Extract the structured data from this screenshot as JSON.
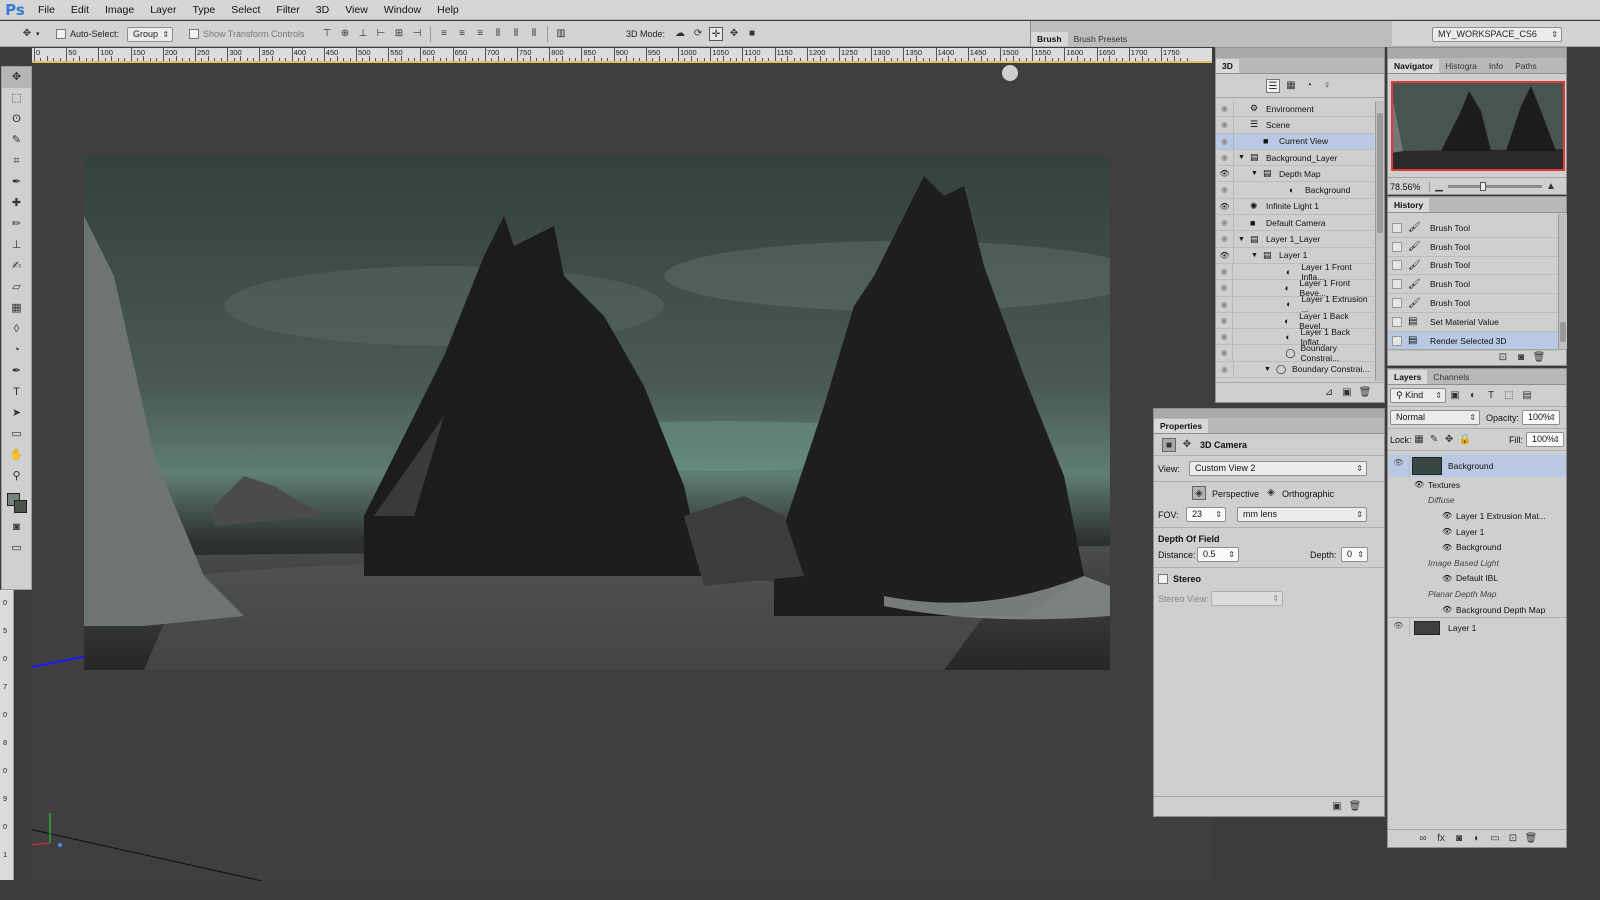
{
  "app": {
    "logo": "Ps"
  },
  "menu": [
    "File",
    "Edit",
    "Image",
    "Layer",
    "Type",
    "Select",
    "Filter",
    "3D",
    "View",
    "Window",
    "Help"
  ],
  "options_bar": {
    "auto_select_label": "Auto-Select:",
    "group_value": "Group",
    "show_transform_label": "Show Transform Controls",
    "mode_label": "3D Mode:",
    "brush_tab": "Brush",
    "brush_presets_tab": "Brush Presets",
    "workspace": "MY_WORKSPACE_CS6"
  },
  "ruler_labels": [
    "0",
    "50",
    "100",
    "150",
    "200",
    "250",
    "300",
    "350",
    "400",
    "450",
    "500",
    "550",
    "600",
    "650",
    "700",
    "750",
    "800",
    "850",
    "900",
    "950",
    "1000",
    "1050",
    "1100",
    "1150",
    "1200",
    "1250",
    "1300",
    "1350",
    "1400",
    "1450",
    "1500",
    "1550",
    "1600",
    "1650",
    "1700",
    "1750"
  ],
  "ruler_left_labels": [
    "0",
    "5",
    "0",
    "7",
    "0",
    "8",
    "0",
    "9",
    "0",
    "1"
  ],
  "tools": [
    "move",
    "marquee",
    "lasso",
    "quick-select",
    "crop",
    "eyedropper",
    "healing",
    "brush",
    "stamp",
    "history-brush",
    "eraser",
    "gradient",
    "blur",
    "dodge",
    "pen",
    "type",
    "path-select",
    "shape",
    "hand",
    "zoom"
  ],
  "panel_3d": {
    "tab": "3D",
    "rows": [
      {
        "label": "Environment",
        "indent": 0,
        "eye": false,
        "expand": "",
        "icon": "environment-icon"
      },
      {
        "label": "Scene",
        "indent": 0,
        "eye": false,
        "expand": "",
        "icon": "scene-icon"
      },
      {
        "label": "Current View",
        "indent": 1,
        "eye": false,
        "expand": "",
        "icon": "camera-icon",
        "selected": true
      },
      {
        "label": "Background_Layer",
        "indent": 0,
        "eye": false,
        "expand": "▼",
        "icon": "mesh-icon"
      },
      {
        "label": "Depth Map",
        "indent": 1,
        "eye": true,
        "expand": "▼",
        "icon": "mesh-icon"
      },
      {
        "label": "Background",
        "indent": 3,
        "eye": false,
        "expand": "",
        "icon": "material-icon"
      },
      {
        "label": "Infinite Light 1",
        "indent": 0,
        "eye": true,
        "expand": "",
        "icon": "light-icon"
      },
      {
        "label": "Default Camera",
        "indent": 0,
        "eye": false,
        "expand": "",
        "icon": "camera-icon"
      },
      {
        "label": "Layer 1_Layer",
        "indent": 0,
        "eye": false,
        "expand": "▼",
        "icon": "mesh-icon"
      },
      {
        "label": "Layer 1",
        "indent": 1,
        "eye": true,
        "expand": "▼",
        "icon": "mesh-icon"
      },
      {
        "label": "Layer 1 Front Infla...",
        "indent": 3,
        "eye": false,
        "expand": "",
        "icon": "material-icon"
      },
      {
        "label": "Layer 1 Front Beve...",
        "indent": 3,
        "eye": false,
        "expand": "",
        "icon": "material-icon"
      },
      {
        "label": "Layer 1 Extrusion ...",
        "indent": 3,
        "eye": false,
        "expand": "",
        "icon": "material-icon"
      },
      {
        "label": "Layer 1 Back Bevel...",
        "indent": 3,
        "eye": false,
        "expand": "",
        "icon": "material-icon"
      },
      {
        "label": "Layer 1 Back Inflat...",
        "indent": 3,
        "eye": false,
        "expand": "",
        "icon": "material-icon"
      },
      {
        "label": "Boundary Constrai...",
        "indent": 3,
        "eye": false,
        "expand": "",
        "icon": "constraint-icon"
      },
      {
        "label": "Boundary Constrai...",
        "indent": 2,
        "eye": false,
        "expand": "▼",
        "icon": "constraint-icon"
      }
    ]
  },
  "properties": {
    "tab": "Properties",
    "title": "3D Camera",
    "view_label": "View:",
    "view_value": "Custom View 2",
    "perspective": "Perspective",
    "orthographic": "Orthographic",
    "fov_label": "FOV:",
    "fov_value": "23",
    "lens_value": "mm lens",
    "dof_heading": "Depth Of Field",
    "distance_label": "Distance:",
    "distance_value": "0.5",
    "depth_label": "Depth:",
    "depth_value": "0",
    "stereo_label": "Stereo",
    "stereo_view_label": "Stereo View:"
  },
  "navigator": {
    "tabs": [
      "Navigator",
      "Histogra",
      "Info",
      "Paths"
    ],
    "zoom": "78.56%"
  },
  "history": {
    "tab": "History",
    "items": [
      {
        "label": "Brush Tool",
        "icon": "brush-icon"
      },
      {
        "label": "Brush Tool",
        "icon": "brush-icon"
      },
      {
        "label": "Brush Tool",
        "icon": "brush-icon"
      },
      {
        "label": "Brush Tool",
        "icon": "brush-icon"
      },
      {
        "label": "Brush Tool",
        "icon": "brush-icon"
      },
      {
        "label": "Set Material Value",
        "icon": "document-icon"
      },
      {
        "label": "Render Selected 3D",
        "icon": "document-icon",
        "selected": true
      }
    ]
  },
  "layers": {
    "tabs": [
      "Layers",
      "Channels"
    ],
    "kind": "Kind",
    "blend": "Normal",
    "opacity_label": "Opacity:",
    "opacity": "100%",
    "lock_label": "Lock:",
    "fill_label": "Fill:",
    "fill": "100%",
    "background_layer": "Background",
    "sublayers": [
      {
        "label": "Textures",
        "indent": 1,
        "eye": true,
        "italic": false
      },
      {
        "label": "Diffuse",
        "indent": 2,
        "eye": false,
        "italic": true
      },
      {
        "label": "Layer 1 Extrusion Mat...",
        "indent": 3,
        "eye": true,
        "italic": false
      },
      {
        "label": "Layer 1",
        "indent": 3,
        "eye": true,
        "italic": false
      },
      {
        "label": "Background",
        "indent": 3,
        "eye": true,
        "italic": false
      },
      {
        "label": "Image Based Light",
        "indent": 2,
        "eye": false,
        "italic": true
      },
      {
        "label": "Default IBL",
        "indent": 3,
        "eye": true,
        "italic": false
      },
      {
        "label": "Planar Depth Map",
        "indent": 2,
        "eye": false,
        "italic": true
      },
      {
        "label": "Background Depth Map",
        "indent": 3,
        "eye": true,
        "italic": false
      }
    ],
    "layer1": "Layer 1"
  },
  "colors": {
    "selection": "#b9c9e3",
    "panel": "#cfcfcf",
    "canvas_bg": "#3f3f3f",
    "accent_line": "#1a1aff"
  }
}
